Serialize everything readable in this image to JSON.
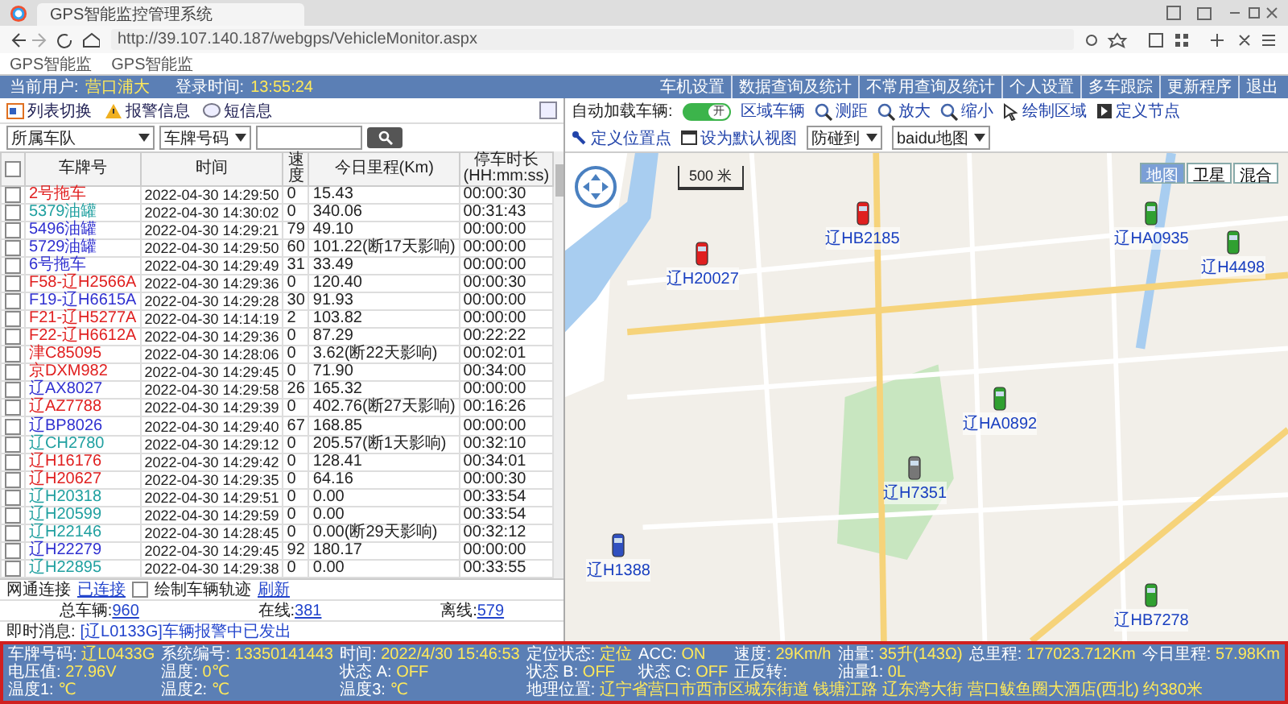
{
  "browser": {
    "tab_title": "GPS智能监控管理系统",
    "url": "http://39.107.140.187/webgps/VehicleMonitor.aspx",
    "bookmarks": [
      "GPS智能监",
      "GPS智能监"
    ]
  },
  "header": {
    "user_label": "当前用户:",
    "user": "营口浦大",
    "login_label": "登录时间:",
    "login_time": "13:55:24",
    "links": [
      "车机设置",
      "数据查询及统计",
      "不常用查询及统计",
      "个人设置",
      "多车跟踪",
      "更新程序",
      "退出"
    ]
  },
  "left_panel": {
    "tools": [
      {
        "label": "列表切换",
        "kind": "list"
      },
      {
        "label": "报警信息",
        "kind": "alert"
      },
      {
        "label": "短信息",
        "kind": "message"
      }
    ],
    "fleet_select": "所属车队",
    "field_select": "车牌号码"
  },
  "table": {
    "select_all": false,
    "columns": [
      "车牌号",
      "时间",
      "速度",
      "今日里程(Km)",
      "停车时长(HH:mm:ss)"
    ],
    "rows": [
      {
        "checked": false,
        "plate": "2号拖车",
        "color": "#e02020",
        "time": "2022-04-30 14:29:50",
        "speed": "0",
        "mileage": "15.43",
        "parked": "00:00:30"
      },
      {
        "checked": false,
        "plate": "5379油罐",
        "color": "#20a0a0",
        "time": "2022-04-30 14:30:02",
        "speed": "0",
        "mileage": "340.06",
        "parked": "00:31:43"
      },
      {
        "checked": false,
        "plate": "5496油罐",
        "color": "#3030d0",
        "time": "2022-04-30 14:29:21",
        "speed": "79",
        "mileage": "49.10",
        "parked": "00:00:00"
      },
      {
        "checked": false,
        "plate": "5729油罐",
        "color": "#3030d0",
        "time": "2022-04-30 14:29:50",
        "speed": "60",
        "mileage": "101.22(断17天影响)",
        "parked": "00:00:00"
      },
      {
        "checked": false,
        "plate": "6号拖车",
        "color": "#3030d0",
        "time": "2022-04-30 14:29:49",
        "speed": "31",
        "mileage": "33.49",
        "parked": "00:00:00"
      },
      {
        "checked": false,
        "plate": "F58-辽H2566A",
        "color": "#e02020",
        "time": "2022-04-30 14:29:36",
        "speed": "0",
        "mileage": "120.40",
        "parked": "00:00:30"
      },
      {
        "checked": false,
        "plate": "F19-辽H6615A",
        "color": "#3030d0",
        "time": "2022-04-30 14:29:28",
        "speed": "30",
        "mileage": "91.93",
        "parked": "00:00:00"
      },
      {
        "checked": false,
        "plate": "F21-辽H5277A",
        "color": "#e02020",
        "time": "2022-04-30 14:14:19",
        "speed": "2",
        "mileage": "103.82",
        "parked": "00:00:00"
      },
      {
        "checked": false,
        "plate": "F22-辽H6612A",
        "color": "#e02020",
        "time": "2022-04-30 14:29:36",
        "speed": "0",
        "mileage": "87.29",
        "parked": "00:22:22"
      },
      {
        "checked": false,
        "plate": "津C85095",
        "color": "#e02020",
        "time": "2022-04-30 14:28:06",
        "speed": "0",
        "mileage": "3.62(断22天影响)",
        "parked": "00:02:01"
      },
      {
        "checked": false,
        "plate": "京DXM982",
        "color": "#e02020",
        "time": "2022-04-30 14:29:45",
        "speed": "0",
        "mileage": "71.90",
        "parked": "00:34:00"
      },
      {
        "checked": false,
        "plate": "辽AX8027",
        "color": "#3030d0",
        "time": "2022-04-30 14:29:58",
        "speed": "26",
        "mileage": "165.32",
        "parked": "00:00:00"
      },
      {
        "checked": false,
        "plate": "辽AZ7788",
        "color": "#e02020",
        "time": "2022-04-30 14:29:39",
        "speed": "0",
        "mileage": "402.76(断27天影响)",
        "parked": "00:16:26"
      },
      {
        "checked": false,
        "plate": "辽BP8026",
        "color": "#3030d0",
        "time": "2022-04-30 14:29:40",
        "speed": "67",
        "mileage": "168.85",
        "parked": "00:00:00"
      },
      {
        "checked": false,
        "plate": "辽CH2780",
        "color": "#20a0a0",
        "time": "2022-04-30 14:29:12",
        "speed": "0",
        "mileage": "205.57(断1天影响)",
        "parked": "00:32:10"
      },
      {
        "checked": false,
        "plate": "辽H16176",
        "color": "#e02020",
        "time": "2022-04-30 14:29:42",
        "speed": "0",
        "mileage": "128.41",
        "parked": "00:34:01"
      },
      {
        "checked": false,
        "plate": "辽H20627",
        "color": "#e02020",
        "time": "2022-04-30 14:29:35",
        "speed": "0",
        "mileage": "64.16",
        "parked": "00:00:30"
      },
      {
        "checked": false,
        "plate": "辽H20318",
        "color": "#20a0a0",
        "time": "2022-04-30 14:29:51",
        "speed": "0",
        "mileage": "0.00",
        "parked": "00:33:54"
      },
      {
        "checked": false,
        "plate": "辽H20599",
        "color": "#20a0a0",
        "time": "2022-04-30 14:29:59",
        "speed": "0",
        "mileage": "0.00",
        "parked": "00:33:54"
      },
      {
        "checked": false,
        "plate": "辽H22146",
        "color": "#20a0a0",
        "time": "2022-04-30 14:28:45",
        "speed": "0",
        "mileage": "0.00(断29天影响)",
        "parked": "00:32:12"
      },
      {
        "checked": false,
        "plate": "辽H22279",
        "color": "#3030d0",
        "time": "2022-04-30 14:29:45",
        "speed": "92",
        "mileage": "180.17",
        "parked": "00:00:00"
      },
      {
        "checked": false,
        "plate": "辽H22895",
        "color": "#20a0a0",
        "time": "2022-04-30 14:29:38",
        "speed": "0",
        "mileage": "0.00",
        "parked": "00:33:55"
      }
    ]
  },
  "connection": {
    "label": "网通连接",
    "status": "已连接",
    "track_checkbox": {
      "label": "绘制车辆轨迹",
      "checked": false
    },
    "refresh": "刷新"
  },
  "totals": [
    {
      "label": "总车辆:",
      "value": "960"
    },
    {
      "label": "在线:",
      "value": "381"
    },
    {
      "label": "离线:",
      "value": "579"
    }
  ],
  "message": {
    "label": "即时消息:",
    "text": "[辽L0133G]车辆报警中已发出"
  },
  "map_toolbar": {
    "autoload_label": "自动加载车辆:",
    "autoload": {
      "on": true,
      "label": "开"
    },
    "tools": [
      {
        "label": "区域车辆",
        "kind": "zone"
      },
      {
        "label": "测距",
        "kind": "measure"
      },
      {
        "label": "放大",
        "kind": "zoom_in"
      },
      {
        "label": "缩小",
        "kind": "zoom_out"
      },
      {
        "label": "绘制区域",
        "kind": "draw"
      },
      {
        "label": "定义节点",
        "kind": "node"
      },
      {
        "label": "定义位置点",
        "kind": "point"
      },
      {
        "label": "设为默认视图",
        "kind": "view"
      }
    ],
    "selects": [
      "防碰到",
      "baidu地图"
    ]
  },
  "map": {
    "scale": "500 米",
    "types": [
      {
        "label": "地图",
        "selected": true
      },
      {
        "label": "卫星",
        "selected": false
      },
      {
        "label": "混合",
        "selected": false
      }
    ],
    "vehicles": [
      {
        "label": "辽H20027",
        "color": "#e02020"
      },
      {
        "label": "辽HB2185",
        "color": "#e02020"
      },
      {
        "label": "辽HA0935",
        "color": "#30a030"
      },
      {
        "label": "辽H4498",
        "color": "#30a030"
      },
      {
        "label": "辽HA0892",
        "color": "#30a030"
      },
      {
        "label": "辽H7351",
        "color": "#777777"
      },
      {
        "label": "辽H1388",
        "color": "#3050c0"
      },
      {
        "label": "辽HB7278",
        "color": "#30a030"
      }
    ]
  },
  "status": {
    "rows": [
      [
        {
          "label": "车牌号码:",
          "value": "辽L0433G"
        },
        {
          "label": "系统编号:",
          "value": "13350141443"
        },
        {
          "label": "时间:",
          "value": "2022/4/30 15:46:53"
        },
        {
          "label": "定位状态:",
          "value": "定位"
        },
        {
          "label": "ACC:",
          "value": "ON"
        },
        {
          "label": "速度:",
          "value": "29Km/h"
        },
        {
          "label": "油量:",
          "value": "35升(143Ω)"
        },
        {
          "label": "总里程:",
          "value": "177023.712Km"
        },
        {
          "label": "今日里程:",
          "value": "57.98Km"
        }
      ],
      [
        {
          "label": "电压值:",
          "value": "27.96V"
        },
        {
          "label": "温度:",
          "value": "0℃"
        },
        {
          "label": "状态 A:",
          "value": "OFF"
        },
        {
          "label": "状态 B:",
          "value": "OFF"
        },
        {
          "label": "状态 C:",
          "value": "OFF"
        },
        {
          "label": "正反转:"
        },
        {
          "label": "油量1:",
          "value": "0L"
        }
      ],
      [
        {
          "label": "温度1:",
          "value": "℃"
        },
        {
          "label": "温度2:",
          "value": "℃"
        },
        {
          "label": "温度3:",
          "value": "℃"
        },
        {
          "label": "地理位置:",
          "value": "辽宁省营口市西市区城东街道 钱塘江路 辽东湾大街 营口鲅鱼圈大酒店(西北) 约380米"
        }
      ]
    ]
  }
}
